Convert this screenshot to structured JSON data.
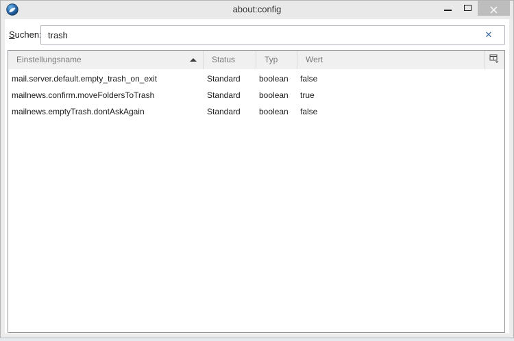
{
  "window": {
    "title": "about:config"
  },
  "icons": {
    "app": "thunderbird-logo",
    "minimize": "minimize-icon",
    "maximize": "maximize-icon",
    "close": "close-icon",
    "search_clear": "clear-search-icon",
    "sort": "sort-ascending-arrow",
    "column_picker": "column-picker-grid"
  },
  "search": {
    "label_access_key": "S",
    "label_rest": "uchen:",
    "value": "trash"
  },
  "table": {
    "columns": [
      {
        "label": "Einstellungsname",
        "sort": "ascending"
      },
      {
        "label": "Status"
      },
      {
        "label": "Typ"
      },
      {
        "label": "Wert"
      }
    ],
    "rows": [
      {
        "name": "mail.server.default.empty_trash_on_exit",
        "status": "Standard",
        "type": "boolean",
        "value": "false"
      },
      {
        "name": "mailnews.confirm.moveFoldersToTrash",
        "status": "Standard",
        "type": "boolean",
        "value": "true"
      },
      {
        "name": "mailnews.emptyTrash.dontAskAgain",
        "status": "Standard",
        "type": "boolean",
        "value": "false"
      }
    ]
  },
  "colors": {
    "titlebar_bg": "#e9e9e9",
    "close_button_bg": "#bdbdbd",
    "clear_icon_blue": "#3a66a2",
    "header_bg": "#f0f0f0",
    "header_text": "#777777",
    "row_text": "#1c1c1c",
    "table_border": "#8f9398",
    "input_border": "#b2b5bb",
    "thunderbird_blue": "#2c6bb2"
  }
}
